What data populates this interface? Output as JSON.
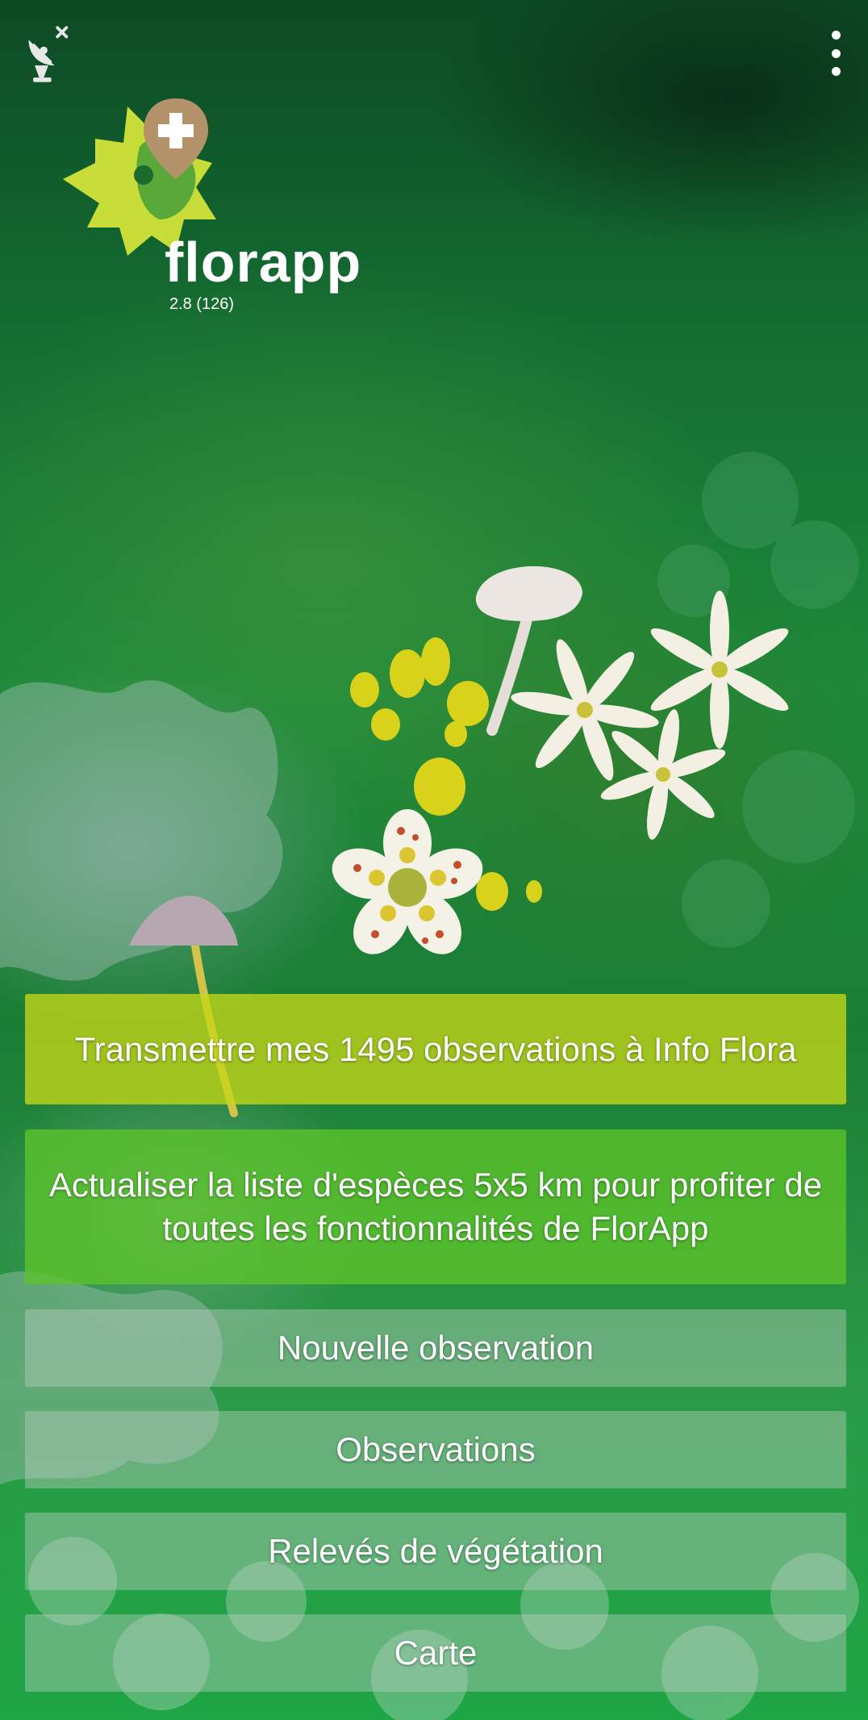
{
  "app": {
    "brand": "florapp",
    "version": "2.8 (126)"
  },
  "icons": {
    "gps_status": "satellite-dish-off-icon",
    "overflow_menu": "more-vertical-icon",
    "logo": "leaf-location-plus-icon"
  },
  "colors": {
    "logo_leaf_light": "#c9dd3a",
    "logo_leaf_dark": "#5aa83a",
    "logo_pin": "#b5936a",
    "transmit_button": "#c4d618",
    "update_button": "#5cc42a",
    "plain_button": "#becdc3"
  },
  "actions": {
    "transmit": "Transmettre mes 1495 observations à Info Flora",
    "update_species": "Actualiser la liste d'espèces 5x5 km pour profiter de toutes les fonctionnalités de FlorApp",
    "new_observation": "Nouvelle observation",
    "observations": "Observations",
    "releves": "Relevés de végétation",
    "map": "Carte"
  }
}
